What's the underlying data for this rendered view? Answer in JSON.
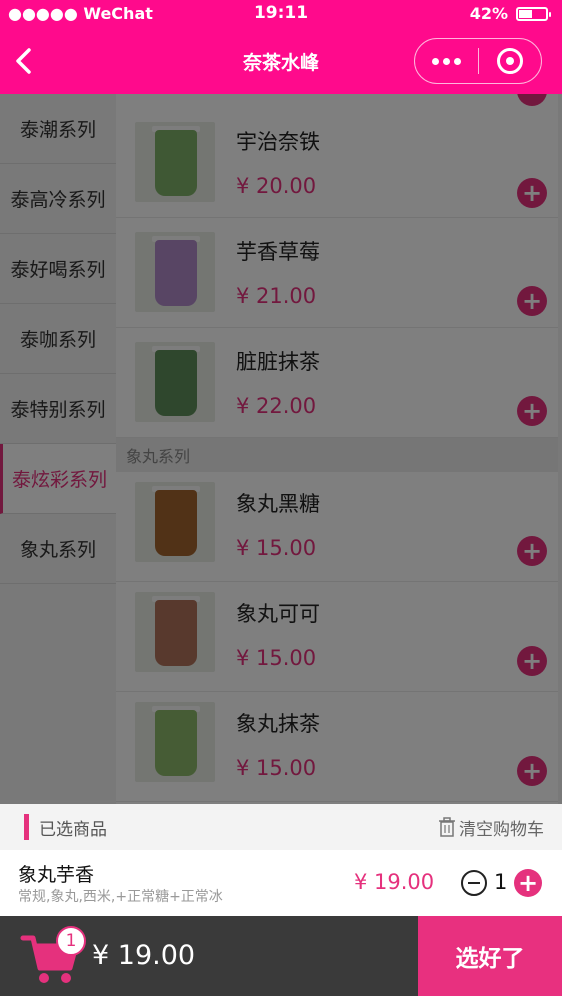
{
  "status_bar": {
    "carrier": "●●●●● WeChat",
    "time": "19:11",
    "battery": "42%",
    "battery_level": 0.42
  },
  "nav": {
    "title": "奈茶水峰"
  },
  "categories": [
    {
      "label": "泰潮系列",
      "active": false
    },
    {
      "label": "泰高冷系列",
      "active": false
    },
    {
      "label": "泰好喝系列",
      "active": false
    },
    {
      "label": "泰咖系列",
      "active": false
    },
    {
      "label": "泰特别系列",
      "active": false
    },
    {
      "label": "泰炫彩系列",
      "active": true
    },
    {
      "label": "象丸系列",
      "active": false
    }
  ],
  "products_a": [
    {
      "name": "宇治奈铁",
      "price": "¥ 20.00",
      "color": "#7fb069"
    },
    {
      "name": "芋香草莓",
      "price": "¥ 21.00",
      "color": "#b08bc9"
    },
    {
      "name": "脏脏抹茶",
      "price": "¥ 22.00",
      "color": "#5f8f5a"
    }
  ],
  "section_label": "象丸系列",
  "products_b": [
    {
      "name": "象丸黑糖",
      "price": "¥ 15.00",
      "color": "#a2652e"
    },
    {
      "name": "象丸可可",
      "price": "¥ 15.00",
      "color": "#b0735a"
    },
    {
      "name": "象丸抹茶",
      "price": "¥ 15.00",
      "color": "#8db86a"
    }
  ],
  "cart": {
    "header_title": "已选商品",
    "clear_label": "清空购物车",
    "item": {
      "name": "象丸芋香",
      "spec": "常规,象丸,西米,+正常糖+正常冰",
      "price": "¥ 19.00",
      "qty": "1"
    },
    "badge": "1",
    "total": "¥ 19.00",
    "checkout_label": "选好了"
  },
  "colors": {
    "brand": "#ff0a8c",
    "accent": "#e5317d"
  }
}
